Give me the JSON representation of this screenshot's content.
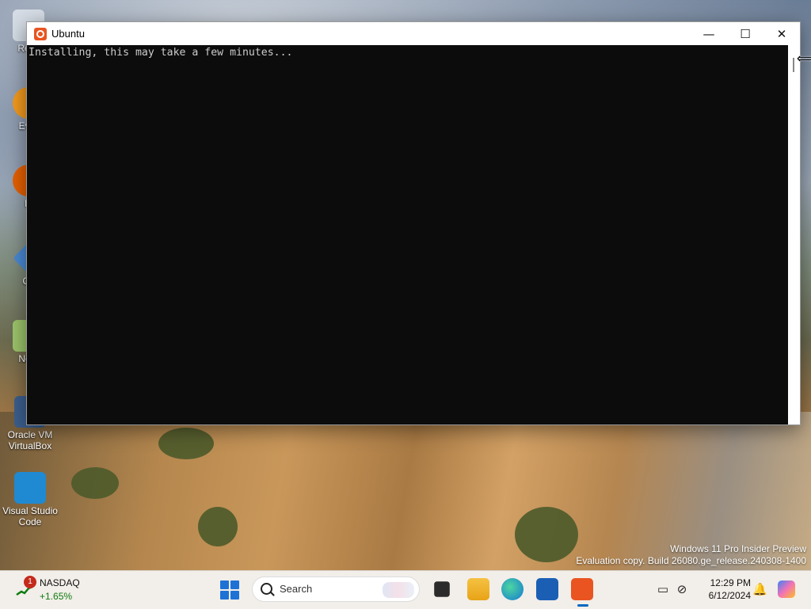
{
  "desktop": {
    "icons": [
      {
        "label": "Recy"
      },
      {
        "label": "Ever"
      },
      {
        "label": "Fi"
      },
      {
        "label": "Git"
      },
      {
        "label": "Note"
      },
      {
        "label": "Oracle VM VirtualBox"
      },
      {
        "label": "Visual Studio Code"
      }
    ],
    "watermark": {
      "line1": "Windows 11 Pro Insider Preview",
      "line2": "Evaluation copy. Build 26080.ge_release.240308-1400"
    }
  },
  "window": {
    "title": "Ubuntu",
    "console_output": "Installing, this may take a few minutes...",
    "buttons": {
      "minimize": "—",
      "maximize": "☐",
      "close": "✕"
    }
  },
  "taskbar": {
    "widget": {
      "name": "NASDAQ",
      "change": "+1.65%",
      "badge": "1"
    },
    "search": {
      "label": "Search"
    },
    "clock": {
      "time": "12:29 PM",
      "date": "6/12/2024"
    },
    "colors": {
      "accent": "#0067c0",
      "ubuntu": "#e95420"
    }
  }
}
